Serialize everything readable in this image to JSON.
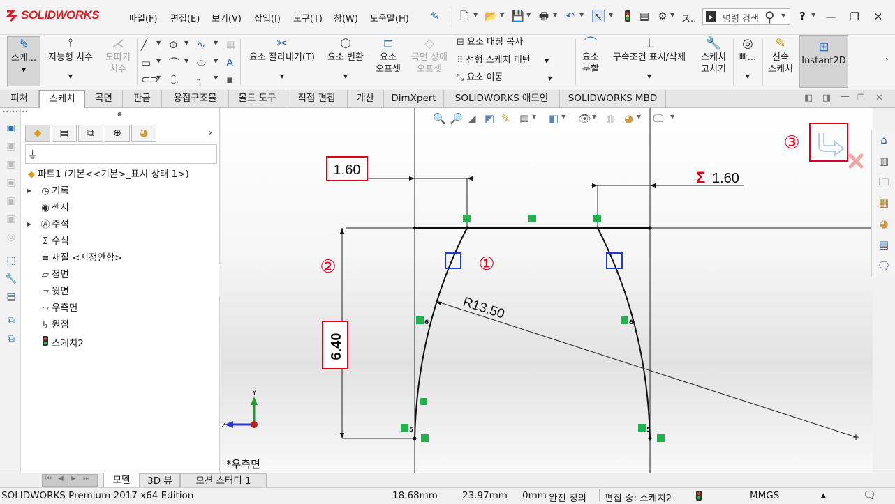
{
  "app": {
    "logo_text": "SOLIDWORKS",
    "menus": [
      "파일(F)",
      "편집(E)",
      "보기(V)",
      "삽입(I)",
      "도구(T)",
      "창(W)",
      "도움말(H)"
    ],
    "search_placeholder": "명령 검색",
    "help_label": "?"
  },
  "ribbon": {
    "sketch": "스케...",
    "smart_dimension": "지능형 치수",
    "fillet_line1": "모따기",
    "fillet_line2": "치수",
    "trim": "요소 잘라내기(T)",
    "convert": "요소 변환",
    "offset_line1": "요소",
    "offset_line2": "오프셋",
    "surface_offset_line1": "곡면 상에",
    "surface_offset_line2": "오프셋",
    "mirror": "요소 대칭 복사",
    "linear_pattern": "선형 스케치 패턴",
    "move": "요소 이동",
    "split_line1": "요소",
    "split_line2": "분할",
    "relations": "구속조건 표시/삭제",
    "repair_line1": "스케치",
    "repair_line2": "고치기",
    "quick_snaps": "빠...",
    "rapid_line1": "신속",
    "rapid_line2": "스케치",
    "instant2d": "Instant2D"
  },
  "tabs": [
    "피처",
    "스케치",
    "곡면",
    "판금",
    "용접구조물",
    "몰드 도구",
    "직접 편집",
    "계산",
    "DimXpert",
    "SOLIDWORKS 애드인",
    "SOLIDWORKS MBD"
  ],
  "active_tab": "스케치",
  "tree": {
    "root": "파트1  (기본<<기본>_표시 상태 1>)",
    "items": [
      "기록",
      "센서",
      "주석",
      "수식",
      "재질 <지정안함>",
      "정면",
      "윗면",
      "우측면",
      "원점",
      "스케치2"
    ]
  },
  "canvas": {
    "dim_top_left": "1.60",
    "dim_top_right": "1.60",
    "dim_top_right_prefix": "Σ",
    "dim_height": "6.40",
    "dim_radius": "R13.50",
    "marker_1": "①",
    "marker_2": "②",
    "marker_3": "③",
    "view_label": "*우측면",
    "axis_y": "Y",
    "axis_z": "Z",
    "rel_small_a": "6",
    "rel_small_b": "5"
  },
  "bottom_tabs": [
    "모델",
    "3D 뷰",
    "모션 스터디 1"
  ],
  "status": {
    "edition": "SOLIDWORKS Premium 2017 x64 Edition",
    "x": "18.68mm",
    "y": "23.97mm",
    "z": "0mm",
    "state": "완전 정의",
    "editing": "편집 중: 스케치2",
    "units": "MMGS"
  },
  "colors": {
    "brand": "#d32027",
    "annotation_red": "#e0001b",
    "relation_green": "#22b14c",
    "highlight_blue": "#1f3bd6"
  }
}
